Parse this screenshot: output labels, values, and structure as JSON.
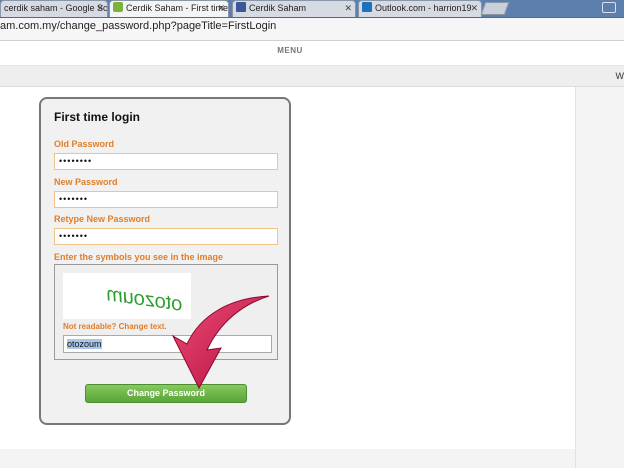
{
  "browser": {
    "tabs": [
      {
        "title": "cerdik saham - Google Sc",
        "active": false
      },
      {
        "title": "Cerdik Saham - First time",
        "active": true
      },
      {
        "title": "Cerdik Saham",
        "active": false
      },
      {
        "title": "Outlook.com - harrion19",
        "active": false
      }
    ],
    "address": "am.com.my/change_password.php?pageTitle=FirstLogin"
  },
  "site": {
    "menu_label": "MENU",
    "strip_text": "W"
  },
  "form": {
    "title": "First time login",
    "old_password_label": "Old Password",
    "old_password_value": "••••••••",
    "new_password_label": "New Password",
    "new_password_value": "•••••••",
    "retype_label": "Retype New Password",
    "retype_value": "•••••••",
    "captcha_label": "Enter the symbols you see in the image",
    "captcha_image_text": "otozoum",
    "captcha_reload": "Not readable? Change text.",
    "captcha_value": "otozoum",
    "submit_label": "Change Password"
  },
  "colors": {
    "label_orange": "#e07e2a",
    "button_green": "#6ab446",
    "arrow_red": "#d6134a"
  }
}
